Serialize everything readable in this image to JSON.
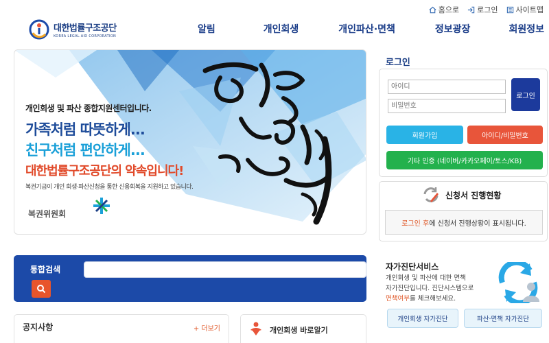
{
  "util_nav": {
    "home": "홈으로",
    "login": "로그인",
    "sitemap": "사이트맵"
  },
  "logo": {
    "korean": "대한법률구조공단",
    "english": "KOREA LEGAL AID CORPORATION"
  },
  "gnb": [
    "알림",
    "개인회생",
    "개인파산·면책",
    "정보광장",
    "회원정보"
  ],
  "hero": {
    "subtitle": "개인회생 및 파산 종합지원센터입니다.",
    "line1": "가족처럼 따뜻하게...",
    "line2": "친구처럼 편안하게...",
    "line3": "대한법률구조공단의 약속입니다!",
    "desc": "복권기금이 개인 회생·파산신청을 통한 신용회복을 지원하고 있습니다.",
    "org": "복권위원회",
    "calligraphy": "희망 사랑 행복"
  },
  "search": {
    "label": "통합검색",
    "value": ""
  },
  "notice": {
    "title": "공지사항",
    "more": "+ 더보기"
  },
  "rebirth_link": "개인회생 바로알기",
  "login": {
    "title": "로그인",
    "id_placeholder": "아이디",
    "pw_placeholder": "비밀번호",
    "submit": "로그인",
    "join": "회원가입",
    "find": "아이디/비밀번호",
    "cert": "기타 인증 (네이버/카카오페이/토스/KB)"
  },
  "status": {
    "title": "신청서 진행현황",
    "msg_hl": "로그인 후",
    "msg_rest": "에 신청서 진행상황이 표시됩니다."
  },
  "self_check": {
    "title": "자가진단서비스",
    "desc1": "개인회생 및 파산에 대한 면책",
    "desc2": "자가진단입니다. 진단시스템으로",
    "desc3_hl": "면책여부",
    "desc3_rest": "를 체크해보세요.",
    "btn1": "개인회생 자가진단",
    "btn2": "파산·면책 자가진단"
  },
  "colors": {
    "brand_navy": "#1c3f85",
    "search_blue": "#1c4aa8",
    "accent_orange": "#e8553a",
    "join_blue": "#29b3e6",
    "cert_green": "#23b14d"
  }
}
